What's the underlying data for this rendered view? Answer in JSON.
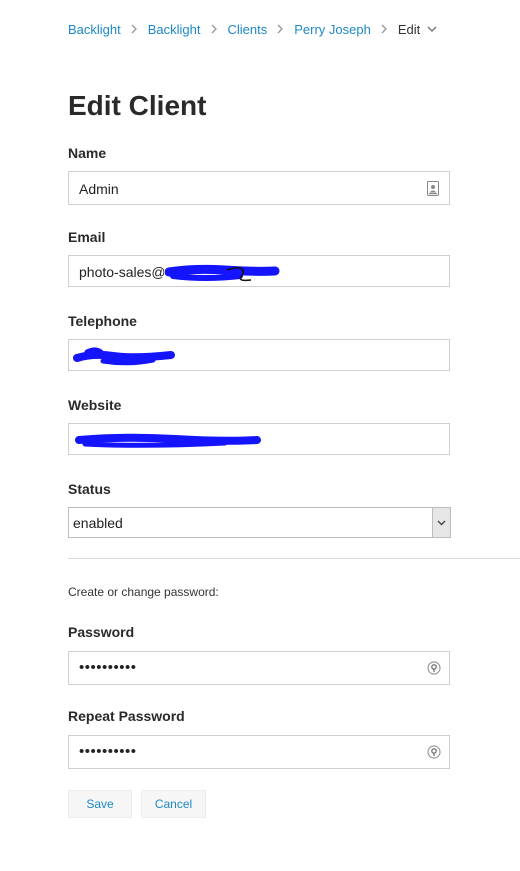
{
  "breadcrumb": {
    "items": [
      "Backlight",
      "Backlight",
      "Clients",
      "Perry Joseph"
    ],
    "current": "Edit"
  },
  "page": {
    "title": "Edit Client"
  },
  "form": {
    "name": {
      "label": "Name",
      "value": "Admin"
    },
    "email": {
      "label": "Email",
      "value": "photo-sales@"
    },
    "telephone": {
      "label": "Telephone"
    },
    "website": {
      "label": "Website"
    },
    "status": {
      "label": "Status",
      "value": "enabled"
    },
    "password_note": "Create or change password:",
    "password": {
      "label": "Password",
      "value": "••••••••••"
    },
    "repeat_password": {
      "label": "Repeat Password",
      "value": "••••••••••"
    }
  },
  "buttons": {
    "save": "Save",
    "cancel": "Cancel"
  },
  "colors": {
    "link": "#1e88c8",
    "redaction": "#1414ff"
  }
}
